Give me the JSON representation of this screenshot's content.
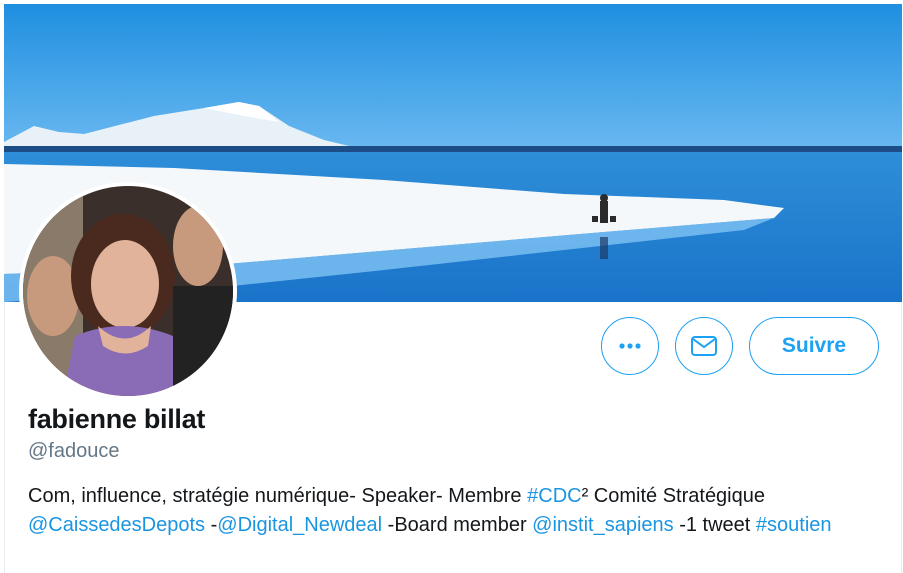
{
  "profile": {
    "display_name": "fabienne billat",
    "handle": "@fadouce",
    "follow_label": "Suivre",
    "bio": [
      {
        "text": "Com, influence, stratégie numérique- Speaker- Membre ",
        "link": false
      },
      {
        "text": "#CDC",
        "link": true
      },
      {
        "text": "² Comité Stratégique ",
        "link": false
      },
      {
        "text": "@CaissedesDepots",
        "link": true
      },
      {
        "text": " -",
        "link": false
      },
      {
        "text": "@Digital_Newdeal",
        "link": true
      },
      {
        "text": " -Board member ",
        "link": false
      },
      {
        "text": "@instit_sapiens",
        "link": true
      },
      {
        "text": " -1 tweet ",
        "link": false
      },
      {
        "text": "#soutien",
        "link": true
      }
    ]
  },
  "icons": {
    "more": "more-dots-icon",
    "message": "envelope-icon"
  },
  "colors": {
    "accent": "#1da1f2",
    "link": "#1b95e0",
    "secondary_text": "#657786"
  }
}
